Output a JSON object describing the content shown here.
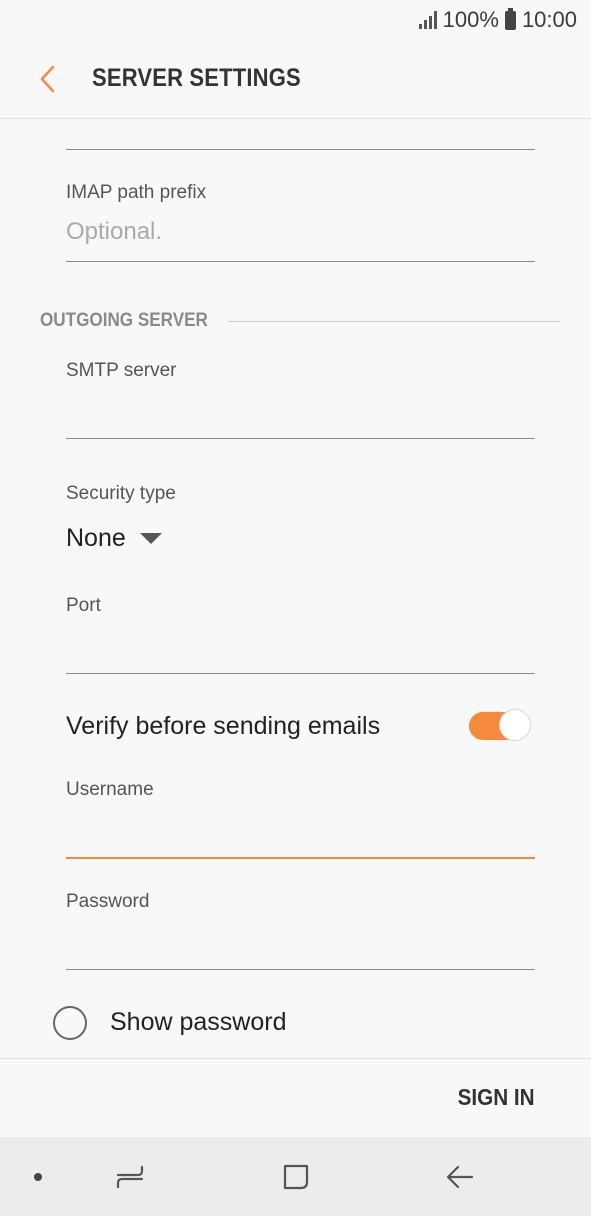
{
  "status_bar": {
    "battery_text": "100%",
    "time": "10:00"
  },
  "header": {
    "title": "SERVER SETTINGS",
    "back_icon": "chevron-left-icon",
    "accent_color": "#f58a3c"
  },
  "fields": {
    "imap_prefix": {
      "label": "IMAP path prefix",
      "placeholder": "Optional.",
      "value": ""
    },
    "smtp_server": {
      "label": "SMTP server",
      "value": ""
    },
    "security_type": {
      "label": "Security type",
      "value": "None"
    },
    "port": {
      "label": "Port",
      "value": ""
    },
    "username": {
      "label": "Username",
      "value": ""
    },
    "password": {
      "label": "Password",
      "value": ""
    }
  },
  "sections": {
    "outgoing": "OUTGOING SERVER"
  },
  "verify": {
    "label": "Verify before sending emails",
    "enabled": true
  },
  "show_password": {
    "label": "Show password",
    "checked": false
  },
  "actions": {
    "sign_in": "SIGN IN"
  },
  "nav": {
    "items": [
      "dot-icon",
      "recents-icon",
      "home-icon",
      "back-icon"
    ]
  }
}
